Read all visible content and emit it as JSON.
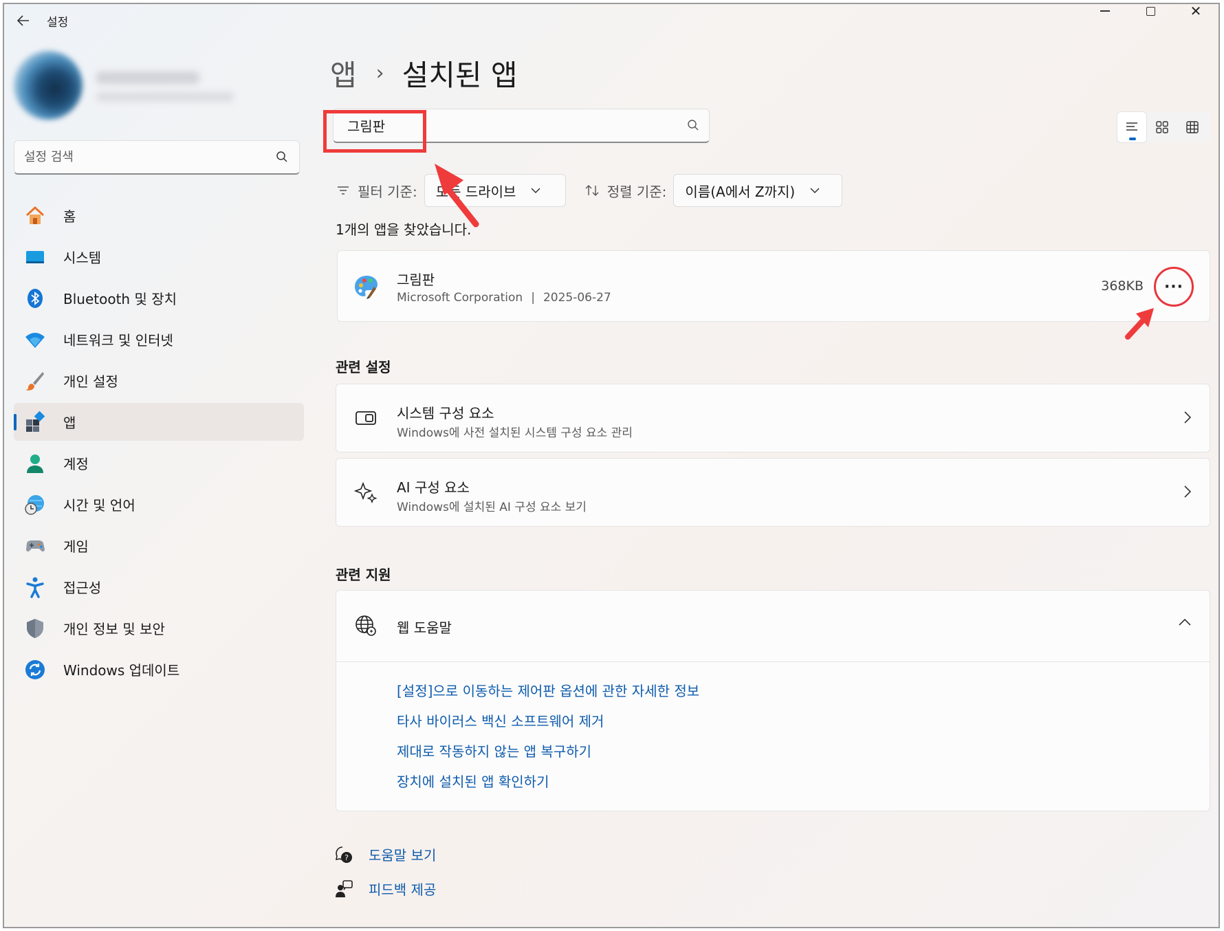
{
  "window": {
    "title": "설정",
    "back_icon": "back-arrow-icon",
    "minimize_icon": "minimize-icon",
    "maximize_icon": "maximize-icon",
    "close_icon": "close-icon",
    "close_glyph": "✕"
  },
  "sidebar": {
    "search_placeholder": "설정 검색",
    "items": [
      {
        "label": "홈",
        "icon": "home-icon"
      },
      {
        "label": "시스템",
        "icon": "system-icon"
      },
      {
        "label": "Bluetooth 및 장치",
        "icon": "bluetooth-icon"
      },
      {
        "label": "네트워크 및 인터넷",
        "icon": "wifi-icon"
      },
      {
        "label": "개인 설정",
        "icon": "brush-icon"
      },
      {
        "label": "앱",
        "icon": "apps-icon",
        "active": true
      },
      {
        "label": "계정",
        "icon": "account-icon"
      },
      {
        "label": "시간 및 언어",
        "icon": "time-language-icon"
      },
      {
        "label": "게임",
        "icon": "gamepad-icon"
      },
      {
        "label": "접근성",
        "icon": "accessibility-icon"
      },
      {
        "label": "개인 정보 및 보안",
        "icon": "shield-icon"
      },
      {
        "label": "Windows 업데이트",
        "icon": "update-icon"
      }
    ]
  },
  "breadcrumb": {
    "parent": "앱",
    "separator": "›",
    "current": "설치된 앱"
  },
  "app_search": {
    "value": "그림판"
  },
  "view_toggle": {
    "options": [
      "list-view-icon",
      "tile-view-icon",
      "grid-view-icon"
    ],
    "selected": "list-view-icon"
  },
  "filter": {
    "label": "필터 기준:",
    "value": "모든 드라이브",
    "sort_label": "정렬 기준:",
    "sort_value": "이름(A에서 Z까지)"
  },
  "result_count": "1개의 앱을 찾았습니다.",
  "app": {
    "name": "그림판",
    "publisher": "Microsoft Corporation",
    "separator": "|",
    "date": "2025-06-27",
    "size": "368KB",
    "more_label": "···",
    "icon": "paint-palette-icon"
  },
  "related_settings": {
    "title": "관련 설정",
    "items": [
      {
        "title": "시스템 구성 요소",
        "desc": "Windows에 사전 설치된 시스템 구성 요소 관리",
        "icon": "system-components-icon"
      },
      {
        "title": "AI 구성 요소",
        "desc": "Windows에 설치된 AI 구성 요소 보기",
        "icon": "sparkle-icon"
      }
    ]
  },
  "related_support": {
    "title": "관련 지원",
    "card_title": "웹 도움말",
    "icon": "globe-icon",
    "links": [
      "[설정]으로 이동하는 제어판 옵션에 관한 자세한 정보",
      "타사 바이러스 백신 소프트웨어 제거",
      "제대로 작동하지 않는 앱 복구하기",
      "장치에 설치된 앱 확인하기"
    ]
  },
  "footer": {
    "help": "도움말 보기",
    "feedback": "피드백 제공"
  },
  "colors": {
    "accent": "#0067c0",
    "annotation_red": "#ef3b3b",
    "link": "#0f5cad"
  }
}
